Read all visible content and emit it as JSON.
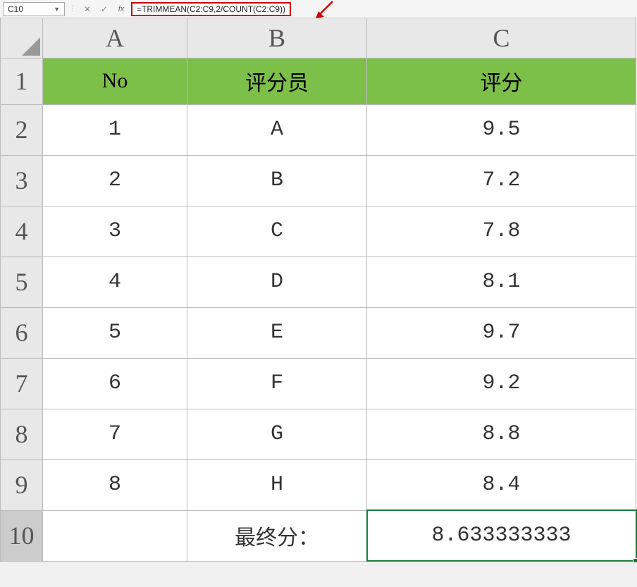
{
  "formula_bar": {
    "cell_ref": "C10",
    "cancel_label": "✕",
    "confirm_label": "✓",
    "fx_label": "fx",
    "formula": "=TRIMMEAN(C2:C9,2/COUNT(C2:C9))"
  },
  "columns": {
    "A": "A",
    "B": "B",
    "C": "C"
  },
  "row_numbers": [
    "1",
    "2",
    "3",
    "4",
    "5",
    "6",
    "7",
    "8",
    "9",
    "10"
  ],
  "table": {
    "headers": {
      "no": "No",
      "rater": "评分员",
      "score": "评分"
    },
    "rows": [
      {
        "no": "1",
        "rater": "A",
        "score": "9.5"
      },
      {
        "no": "2",
        "rater": "B",
        "score": "7.2"
      },
      {
        "no": "3",
        "rater": "C",
        "score": "7.8"
      },
      {
        "no": "4",
        "rater": "D",
        "score": "8.1"
      },
      {
        "no": "5",
        "rater": "E",
        "score": "9.7"
      },
      {
        "no": "6",
        "rater": "F",
        "score": "9.2"
      },
      {
        "no": "7",
        "rater": "G",
        "score": "8.8"
      },
      {
        "no": "8",
        "rater": "H",
        "score": "8.4"
      }
    ],
    "final": {
      "label": "最终分：",
      "value": "8.633333333"
    }
  }
}
